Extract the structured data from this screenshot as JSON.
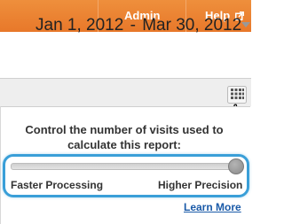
{
  "header": {
    "admin_label": "Admin",
    "help_label": "Help",
    "background_color": "#e8782a"
  },
  "date_range": {
    "start": "Jan 1, 2012",
    "separator": "-",
    "end": "Mar 30, 2012"
  },
  "sampling": {
    "button_icon": "grid-icon",
    "instruction": "Control the number of visits used to calculate this report:",
    "slider": {
      "value_fraction": 1.0,
      "min_label": "Faster Processing",
      "max_label": "Higher Precision"
    },
    "learn_more_label": "Learn More",
    "highlight_color": "#3a9fd8"
  }
}
